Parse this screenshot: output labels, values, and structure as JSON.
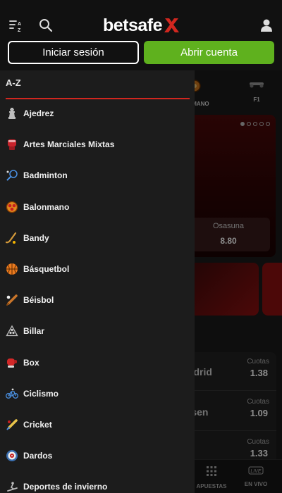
{
  "header": {
    "logo_text": "betsafe",
    "login_label": "Iniciar sesión",
    "register_label": "Abrir cuenta",
    "colors": {
      "brand_red": "#d1271f",
      "cta_green": "#5fb11e"
    }
  },
  "background": {
    "sport_tabs": [
      {
        "label": "LONMANO",
        "icon": "handball-icon"
      },
      {
        "label": "F1",
        "icon": "f1-car-icon"
      }
    ],
    "banner_team": "Osasuna",
    "banner_odd": "8.80",
    "matches": [
      {
        "name": "Madrid",
        "quota_label": "Cuotas",
        "quota": "1.38"
      },
      {
        "name": "kusen",
        "quota_label": "Cuotas",
        "quota": "1.09"
      },
      {
        "name": "",
        "quota_label": "Cuotas",
        "quota": "1.33"
      }
    ],
    "bottom_nav": [
      {
        "label": "APUESTAS",
        "icon": "grid-icon"
      },
      {
        "label": "EN VIVO",
        "icon": "live-icon"
      }
    ]
  },
  "drawer": {
    "title": "A-Z",
    "sports": [
      {
        "label": "Ajedrez",
        "icon": "chess-icon"
      },
      {
        "label": "Artes Marciales Mixtas",
        "icon": "mma-glove-icon"
      },
      {
        "label": "Badminton",
        "icon": "badminton-icon"
      },
      {
        "label": "Balonmano",
        "icon": "handball-icon"
      },
      {
        "label": "Bandy",
        "icon": "bandy-stick-icon"
      },
      {
        "label": "Básquetbol",
        "icon": "basketball-icon"
      },
      {
        "label": "Béisbol",
        "icon": "baseball-bat-icon"
      },
      {
        "label": "Billar",
        "icon": "billiards-icon"
      },
      {
        "label": "Box",
        "icon": "boxing-glove-icon"
      },
      {
        "label": "Ciclismo",
        "icon": "bicycle-icon"
      },
      {
        "label": "Cricket",
        "icon": "cricket-icon"
      },
      {
        "label": "Dardos",
        "icon": "dartboard-icon"
      },
      {
        "label": "Deportes de invierno",
        "icon": "winter-sports-icon"
      }
    ]
  }
}
